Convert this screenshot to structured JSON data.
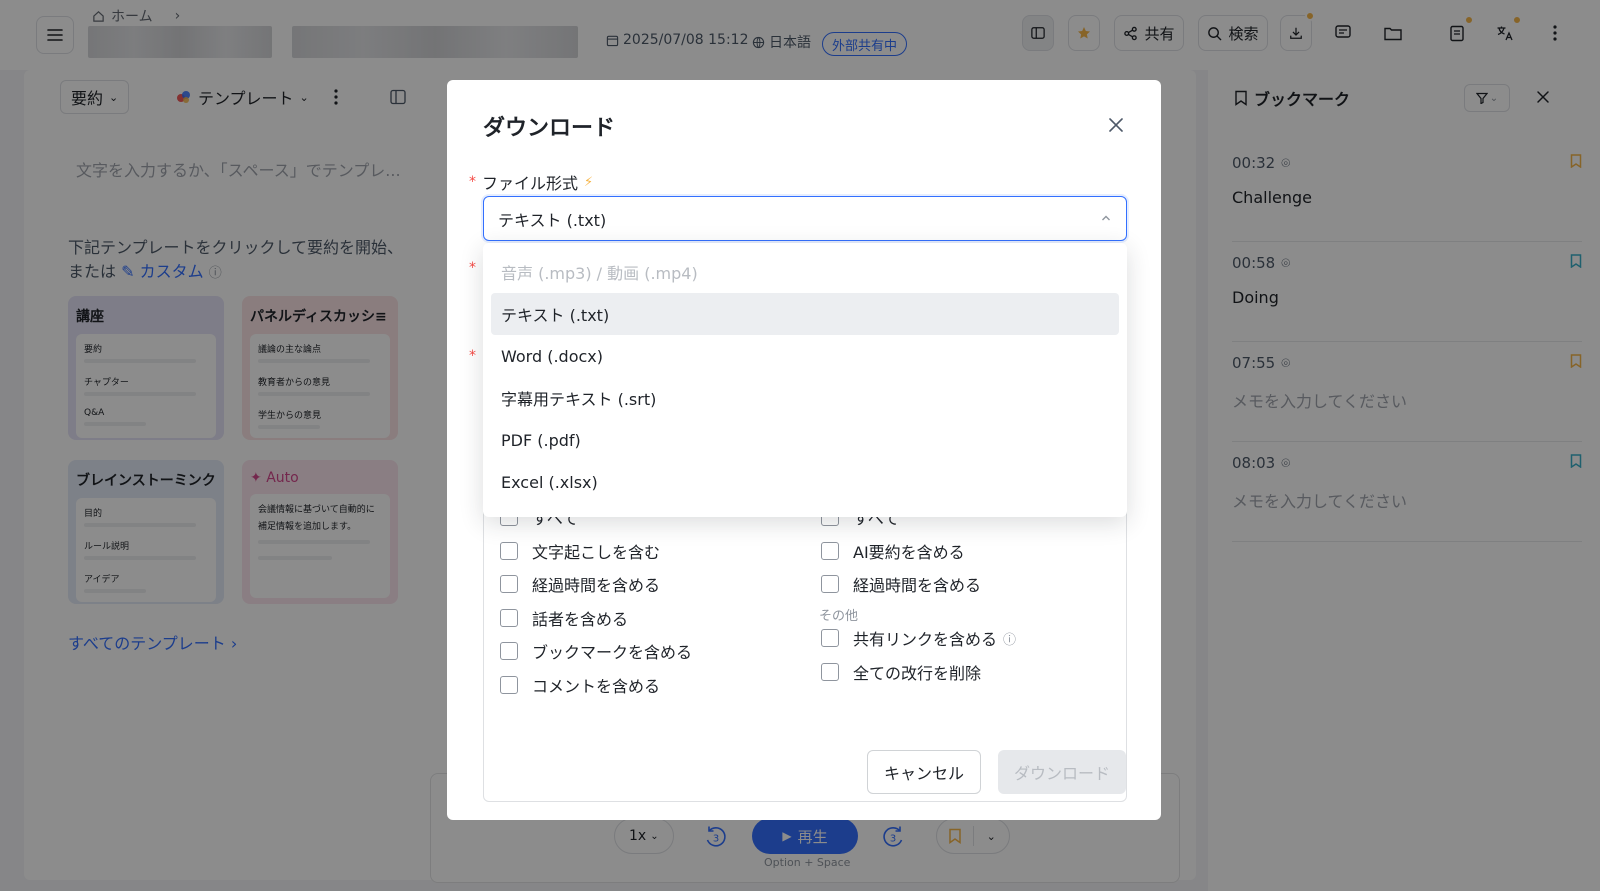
{
  "topbar": {
    "breadcrumb_home": "ホーム",
    "datetime": "2025/07/08 15:12",
    "language": "日本語",
    "share_badge": "外部共有中",
    "share_label": "共有",
    "search_label": "検索"
  },
  "toolbar": {
    "summary_label": "要約",
    "template_label": "テンプレート"
  },
  "editor": {
    "placeholder": "文字を入力するか、「スペース」でテンプレ...",
    "intro_line1": "下記テンプレートをクリックして要約を開始、",
    "intro_line2_prefix": "または",
    "custom_link": "カスタム",
    "all_templates": "すべてのテンプレート"
  },
  "templates": [
    {
      "title": "講座",
      "rows": [
        "要約",
        "チャプター",
        "Q&A"
      ]
    },
    {
      "title": "パネルディスカッシ≡",
      "rows": [
        "議論の主な論点",
        "教育者からの意見",
        "学生からの意見"
      ]
    },
    {
      "title": "ブレインストーミンク",
      "rows": [
        "目的",
        "ルール説明",
        "アイデア"
      ]
    },
    {
      "title": "Auto",
      "rows": [
        "会議情報に基づいて自動的に",
        "補足情報を追加します。"
      ]
    }
  ],
  "bookmarks": {
    "title": "ブックマーク",
    "items": [
      {
        "time": "00:32",
        "text": "Challenge",
        "is_placeholder": false,
        "flag_color": "#f6b64a"
      },
      {
        "time": "00:58",
        "text": "Doing",
        "is_placeholder": false,
        "flag_color": "#3ab0c8"
      },
      {
        "time": "07:55",
        "text": "メモを入力してください",
        "is_placeholder": true,
        "flag_color": "#f6b64a"
      },
      {
        "time": "08:03",
        "text": "メモを入力してください",
        "is_placeholder": true,
        "flag_color": "#3ab0c8"
      }
    ]
  },
  "player": {
    "speed": "1x",
    "skip_seconds": "3",
    "play_label": "再生",
    "hint": "Option + Space"
  },
  "modal": {
    "title": "ダウンロード",
    "file_format_label": "ファイル形式",
    "selected_format": "テキスト (.txt)",
    "options": [
      {
        "label": "音声 (.mp3) / 動画 (.mp4)",
        "disabled": true,
        "selected": false
      },
      {
        "label": "テキスト (.txt)",
        "disabled": false,
        "selected": true
      },
      {
        "label": "Word (.docx)",
        "disabled": false,
        "selected": false
      },
      {
        "label": "字幕用テキスト (.srt)",
        "disabled": false,
        "selected": false
      },
      {
        "label": "PDF (.pdf)",
        "disabled": false,
        "selected": false
      },
      {
        "label": "Excel (.xlsx)",
        "disabled": false,
        "selected": false
      }
    ],
    "left_options": [
      "すべて",
      "文字起こしを含む",
      "経過時間を含める",
      "話者を含める",
      "ブックマークを含める",
      "コメントを含める"
    ],
    "right_options": [
      "すべて",
      "AI要約を含める",
      "経過時間を含める"
    ],
    "other_label": "その他",
    "other_options": [
      "共有リンクを含める",
      "全ての改行を削除"
    ],
    "cancel_label": "キャンセル",
    "download_label": "ダウンロード"
  },
  "colors": {
    "accent": "#3370ff",
    "star": "#f6b64a",
    "required": "#f54a45"
  }
}
